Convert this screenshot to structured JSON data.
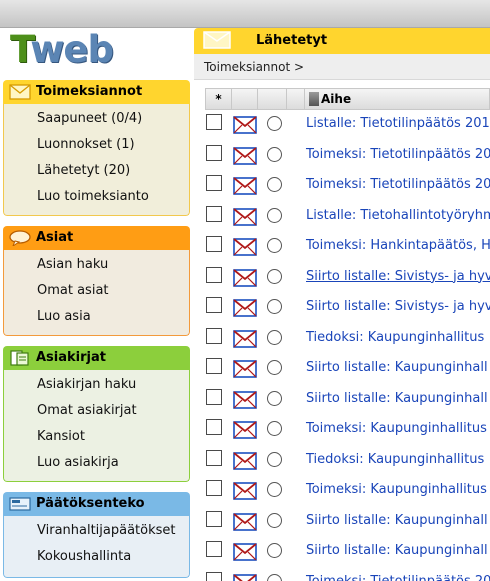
{
  "logo": {
    "t": "T",
    "rest": "web"
  },
  "sidebar": {
    "toimeksiannot": {
      "title": "Toimeksiannot",
      "items": [
        "Saapuneet  (0/4)",
        "Luonnokset  (1)",
        "Lähetetyt  (20)",
        "Luo toimeksianto"
      ]
    },
    "asiat": {
      "title": "Asiat",
      "items": [
        "Asian haku",
        "Omat asiat",
        "Luo asia"
      ]
    },
    "asiakirjat": {
      "title": "Asiakirjat",
      "items": [
        "Asiakirjan haku",
        "Omat asiakirjat",
        "Kansiot",
        "Luo asiakirja"
      ]
    },
    "paatoksenteko": {
      "title": "Päätöksenteko",
      "items": [
        "Viranhaltijapäätökset",
        "Kokoushallinta"
      ]
    }
  },
  "main": {
    "title": "Lähetetyt",
    "breadcrumb": "Toimeksiannot >",
    "table": {
      "star_header": "*",
      "subject_header": "Aihe",
      "rows": [
        {
          "subject": "Listalle: Tietotilinpäätös 201"
        },
        {
          "subject": "Toimeksi: Tietotilinpäätös 20"
        },
        {
          "subject": "Toimeksi: Tietotilinpäätös 20"
        },
        {
          "subject": "Listalle: Tietohallintotyöryhm"
        },
        {
          "subject": "Toimeksi: Hankintapäätös, H"
        },
        {
          "subject": "Siirto listalle: Sivistys- ja hyv"
        },
        {
          "subject": "Siirto listalle: Sivistys- ja hyv"
        },
        {
          "subject": "Tiedoksi: Kaupunginhallitus"
        },
        {
          "subject": "Siirto listalle: Kaupunginhall"
        },
        {
          "subject": "Siirto listalle: Kaupunginhall"
        },
        {
          "subject": "Toimeksi: Kaupunginhallitus"
        },
        {
          "subject": "Tiedoksi: Kaupunginhallitus"
        },
        {
          "subject": "Toimeksi: Kaupunginhallitus"
        },
        {
          "subject": "Siirto listalle: Kaupunginhall"
        },
        {
          "subject": "Siirto listalle: Kaupunginhall"
        },
        {
          "subject": "Toimeksi: Tietotilinpäätös 20"
        }
      ]
    }
  },
  "colors": {
    "toimeksiannot": "#ffd52e",
    "asiat": "#ff9d14",
    "asiakirjat": "#8ccf3c",
    "paatoksenteko": "#7ab9e6",
    "link": "#1a45b9"
  },
  "icons": {
    "toimeksiannot": "envelope-icon",
    "asiat": "speech-bubble-icon",
    "asiakirjat": "document-icon",
    "paatoksenteko": "meeting-icon",
    "row": "sent-envelope-icon"
  }
}
